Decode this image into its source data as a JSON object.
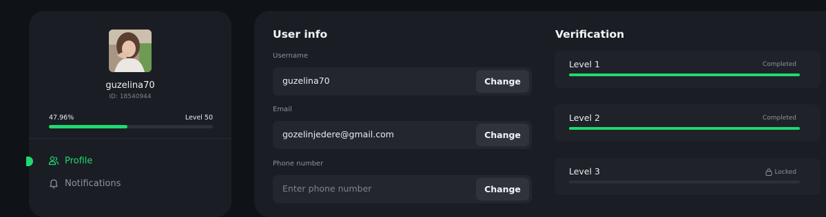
{
  "profile": {
    "username": "guzelina70",
    "id_text": "ID: 18540944",
    "progress_percent_text": "47.96%",
    "progress_fraction": 0.4796,
    "level_text": "Level 50"
  },
  "nav": {
    "items": [
      {
        "label": "Profile",
        "icon": "user-group-icon",
        "active": true
      },
      {
        "label": "Notifications",
        "icon": "bell-icon",
        "active": false
      }
    ]
  },
  "user_info": {
    "title": "User info",
    "fields": [
      {
        "label": "Username",
        "value": "guzelina70",
        "placeholder": "",
        "button": "Change"
      },
      {
        "label": "Email",
        "value": "gozelinjedere@gmail.com",
        "placeholder": "",
        "button": "Change"
      },
      {
        "label": "Phone number",
        "value": "",
        "placeholder": "Enter phone number",
        "button": "Change"
      }
    ]
  },
  "verification": {
    "title": "Verification",
    "levels": [
      {
        "name": "Level 1",
        "status": "Completed",
        "progress": 1.0
      },
      {
        "name": "Level 2",
        "status": "Completed",
        "progress": 1.0
      },
      {
        "name": "Level 3",
        "status": "Locked",
        "progress": 0.0,
        "icon": "lock-icon"
      }
    ]
  },
  "colors": {
    "accent": "#1fd970",
    "panel": "#1a1d23",
    "background": "#0f1217"
  }
}
